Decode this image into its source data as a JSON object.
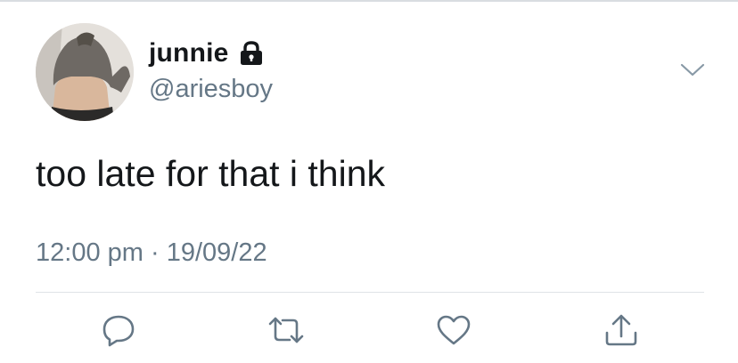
{
  "tweet": {
    "display_name": "junnie",
    "handle": "@ariesboy",
    "text": "too late for that i think",
    "time": "12:00 pm",
    "separator": "·",
    "date": "19/09/22"
  },
  "icons": {
    "lock": "lock-icon",
    "more": "chevron-down-icon",
    "reply": "reply-icon",
    "retweet": "retweet-icon",
    "like": "heart-icon",
    "share": "share-icon"
  },
  "colors": {
    "text_primary": "#14171a",
    "text_secondary": "#657786",
    "icon_gray": "#657786",
    "divider": "#dfe3e7"
  }
}
